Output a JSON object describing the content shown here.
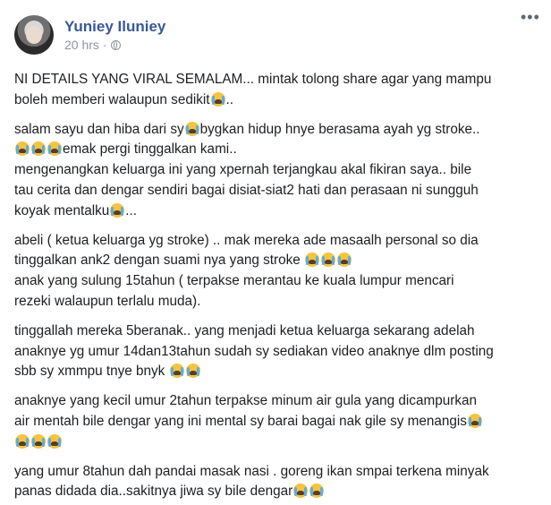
{
  "post": {
    "author": "Yuniey Iluniey",
    "time": "20 hrs",
    "separator": "·",
    "privacy_icon": "globe-icon",
    "options_icon": "more-options-icon",
    "options_glyph": "•••"
  },
  "content": {
    "p1": {
      "l1": "NI DETAILS YANG VIRAL SEMALAM... mintak tolong share agar yang mampu",
      "l2": "boleh memberi walaupun sedikit",
      "l2_tail": ".."
    },
    "p2": {
      "l1a": "salam sayu dan hiba dari sy",
      "l1b": "bygkan hidup hnye berasama ayah yg stroke..",
      "l2": "emak pergi tinggalkan kami..",
      "l3": "mengenangkan keluarga ini yang xpernah terjangkau akal fikiran saya.. bile",
      "l4": "tau cerita dan dengar sendiri bagai disiat-siat2 hati dan perasaan ni sungguh",
      "l5": "koyak mentalku",
      "l5_tail": "..."
    },
    "p3": {
      "l1": "abeli ( ketua keluarga yg stroke) .. mak mereka ade masaalh personal so dia",
      "l2": "tinggalkan ank2 dengan suami nya yang stroke",
      "l3": "anak yang sulung 15tahun ( terpakse merantau ke kuala lumpur mencari",
      "l4": "rezeki walaupun terlalu muda)."
    },
    "p4": {
      "l1": "tinggallah mereka 5beranak.. yang menjadi ketua keluarga sekarang adelah",
      "l2": "anaknye yg umur 14dan13tahun sudah sy sediakan video anaknye dlm posting",
      "l3": "sbb sy xmmpu tnye bnyk"
    },
    "p5": {
      "l1": "anaknye yang kecil umur 2tahun terpakse minum air gula yang dicampurkan",
      "l2": "air mentah bile dengar yang ini mental sy barai bagai nak gile sy menangis"
    },
    "p6": {
      "l1": "yang umur 8tahun dah pandai masak nasi . goreng ikan smpai terkena minyak",
      "l2": "panas didada dia..sakitnya jiwa sy bile dengar"
    }
  }
}
